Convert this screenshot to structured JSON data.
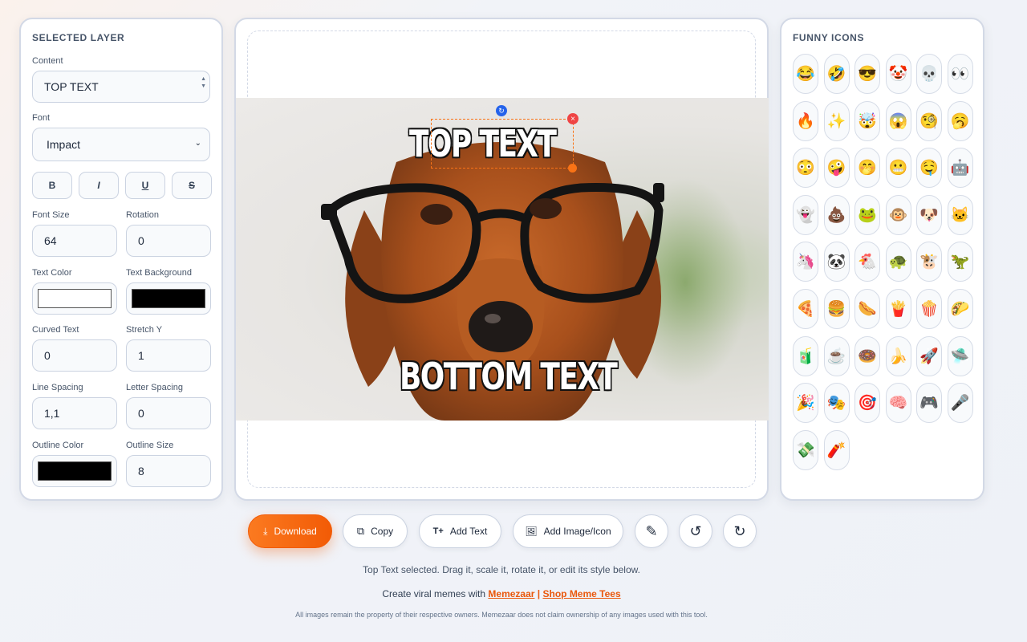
{
  "left_panel": {
    "title": "SELECTED LAYER",
    "content_label": "Content",
    "content_value": "TOP TEXT",
    "font_label": "Font",
    "font_value": "Impact",
    "style_buttons": [
      "B",
      "I",
      "U",
      "S"
    ],
    "font_size_label": "Font Size",
    "font_size_value": "64",
    "rotation_label": "Rotation",
    "rotation_value": "0",
    "text_color_label": "Text Color",
    "text_color": "#ffffff",
    "text_bg_label": "Text Background",
    "text_bg_color": "#000000",
    "curved_label": "Curved Text",
    "curved_value": "0",
    "stretch_label": "Stretch Y",
    "stretch_value": "1",
    "line_spacing_label": "Line Spacing",
    "line_spacing_value": "1,1",
    "letter_spacing_label": "Letter Spacing",
    "letter_spacing_value": "0",
    "outline_color_label": "Outline Color",
    "outline_color": "#000000",
    "outline_size_label": "Outline Size",
    "outline_size_value": "8"
  },
  "canvas": {
    "top_text": "TOP TEXT",
    "bottom_text": "BOTTOM TEXT",
    "selection_color": "#f97316"
  },
  "right_panel": {
    "title": "FUNNY ICONS",
    "icons": [
      "😂",
      "🤣",
      "😎",
      "🤡",
      "💀",
      "👀",
      "🔥",
      "✨",
      "🤯",
      "😱",
      "🧐",
      "🥱",
      "😳",
      "🤪",
      "🤭",
      "😬",
      "🤤",
      "🤖",
      "👻",
      "💩",
      "🐸",
      "🐵",
      "🐶",
      "🐱",
      "🦄",
      "🐼",
      "🐔",
      "🐢",
      "🐮",
      "🦖",
      "🍕",
      "🍔",
      "🌭",
      "🍟",
      "🍿",
      "🌮",
      "🧃",
      "☕",
      "🍩",
      "🍌",
      "🚀",
      "🛸",
      "🎉",
      "🎭",
      "🎯",
      "🧠",
      "🎮",
      "🎤",
      "💸",
      "🧨"
    ]
  },
  "toolbar": {
    "download": "Download",
    "copy": "Copy",
    "add_text": "Add Text",
    "add_image": "Add Image/Icon",
    "accent": "#f25b06"
  },
  "footer": {
    "status": "Top Text selected. Drag it, scale it, rotate it, or edit its style below.",
    "promo_prefix": "Create viral memes with",
    "link1": "Memezaar",
    "separator": "|",
    "link2": "Shop Meme Tees",
    "disclaimer": "All images remain the property of their respective owners. Memezaar does not claim ownership of any images used with this tool."
  }
}
